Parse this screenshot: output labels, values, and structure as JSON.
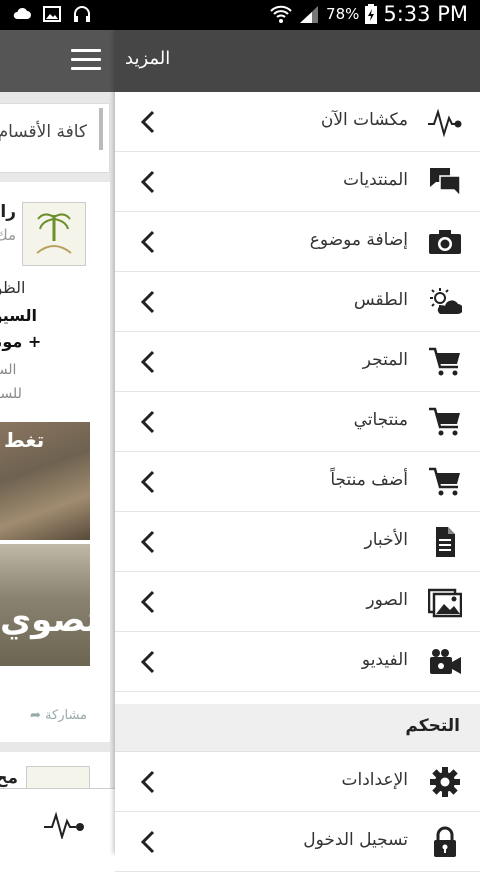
{
  "status_bar": {
    "battery_percent": "78%",
    "time": "5:33 PM"
  },
  "background_panel": {
    "sections_dropdown": "كافة الأقسام",
    "post": {
      "author": "راف",
      "author_sub": "مك",
      "line1": "الظواهر الجو",
      "line2": "السيول التار",
      "line3": "+ مونتاج في",
      "line4": "السلام عليكم",
      "line5": "للسيول التاري",
      "image1_caption": "تغط",
      "image2_caption": "تصوي",
      "share_label": "مشاركة"
    },
    "post2_author": "مح"
  },
  "drawer": {
    "title": "المزيد",
    "items": [
      {
        "label": "مكشات الآن",
        "icon": "pulse-icon"
      },
      {
        "label": "المنتديات",
        "icon": "chat-bubbles-icon"
      },
      {
        "label": "إضافة موضوع",
        "icon": "camera-icon"
      },
      {
        "label": "الطقس",
        "icon": "weather-icon"
      },
      {
        "label": "المتجر",
        "icon": "cart-icon"
      },
      {
        "label": "منتجاتي",
        "icon": "cart-icon"
      },
      {
        "label": "أضف منتجاً",
        "icon": "cart-icon"
      },
      {
        "label": "الأخبار",
        "icon": "document-icon"
      },
      {
        "label": "الصور",
        "icon": "images-icon"
      },
      {
        "label": "الفيديو",
        "icon": "video-camera-icon"
      }
    ],
    "section_title": "التحكم",
    "control_items": [
      {
        "label": "الإعدادات",
        "icon": "gear-icon"
      },
      {
        "label": "تسجيل الدخول",
        "icon": "lock-icon"
      }
    ]
  }
}
